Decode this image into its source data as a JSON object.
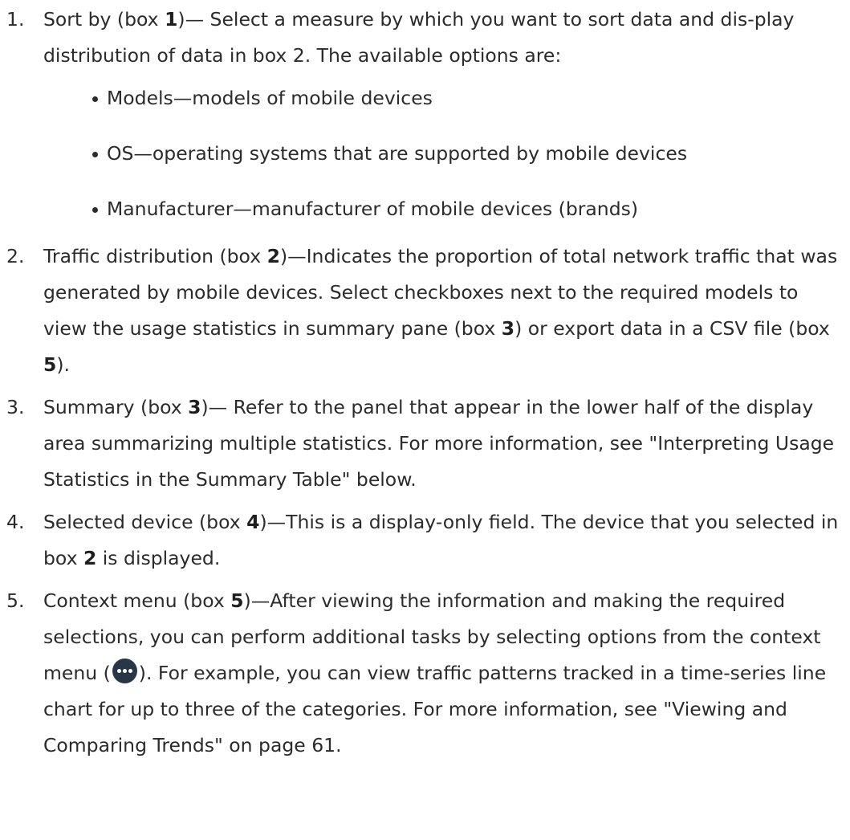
{
  "items": [
    {
      "num": "1.",
      "t1": "Sort by (box ",
      "b1": "1",
      "t2": ")— Select a measure by which you want to sort data and dis-play distribution of data in box 2. The available options are:",
      "options": [
        "Models—models of mobile devices",
        "OS—operating systems that are supported by mobile devices",
        "Manufacturer—manufacturer of mobile devices (brands)"
      ]
    },
    {
      "num": "2.",
      "t1": "Traffic distribution (box ",
      "b1": "2",
      "t2": ")—Indicates the proportion of total network traffic that was generated by mobile devices. Select checkboxes next to the required models to view the usage statistics in summary pane (box ",
      "b2": "3",
      "t3": ") or export data in a CSV file (box ",
      "b3": "5",
      "t4": ")."
    },
    {
      "num": "3.",
      "t1": "Summary (box ",
      "b1": "3",
      "t2": ")— Refer to the panel that appear in the lower half of the display area summarizing multiple statistics. For more information, see \"Interpreting Usage Statistics in the Summary Table\" below."
    },
    {
      "num": "4.",
      "t1": "Selected device (box ",
      "b1": "4",
      "t2": ")—This is a display-only field. The device that you selected in box ",
      "b2": "2",
      "t3": " is displayed."
    },
    {
      "num": "5.",
      "t1": "Context menu (box ",
      "b1": "5",
      "t2": ")—After viewing the information and making the required selections, you can perform additional tasks by selecting options from the context menu (",
      "icon": "more-options-icon",
      "t3": "). For example, you can view traffic patterns tracked in a time-series line chart for up to three of the categories. For more information, see \"Viewing and Comparing Trends\" on page 61."
    }
  ]
}
